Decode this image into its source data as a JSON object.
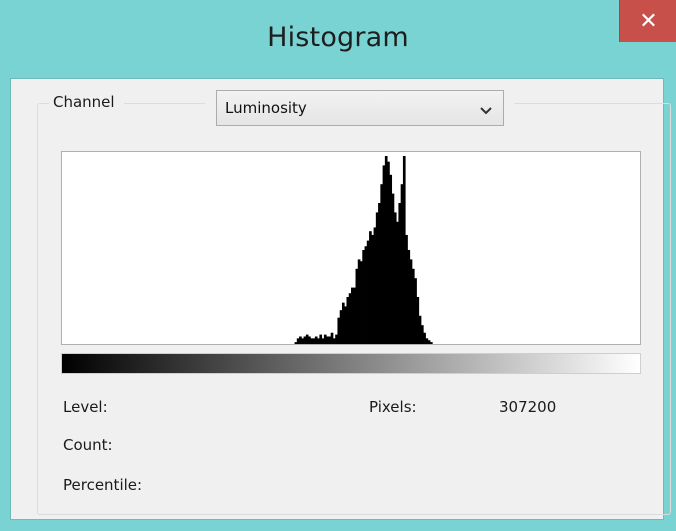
{
  "window": {
    "title": "Histogram",
    "close_glyph": "✕"
  },
  "channel": {
    "label": "Channel",
    "selected": "Luminosity"
  },
  "stats": {
    "level_label": "Level:",
    "count_label": "Count:",
    "percentile_label": "Percentile:",
    "pixels_label": "Pixels:",
    "pixels_value": "307200"
  },
  "chart_data": {
    "type": "area",
    "title": "",
    "xlabel": "",
    "ylabel": "",
    "xlim": [
      0,
      255
    ],
    "ylim": [
      0,
      1
    ],
    "grid": false,
    "x": [
      102,
      103,
      104,
      105,
      106,
      107,
      108,
      109,
      110,
      111,
      112,
      113,
      114,
      115,
      116,
      117,
      118,
      119,
      120,
      121,
      122,
      123,
      124,
      125,
      126,
      127,
      128,
      129,
      130,
      131,
      132,
      133,
      134,
      135,
      136,
      137,
      138,
      139,
      140,
      141,
      142,
      143,
      144,
      145,
      146,
      147,
      148,
      149,
      150,
      151,
      152,
      153,
      154,
      155,
      156,
      157,
      158,
      159,
      160,
      161,
      162,
      163,
      164,
      165,
      166,
      167,
      168,
      169
    ],
    "values": [
      0.0,
      0.01,
      0.03,
      0.04,
      0.03,
      0.04,
      0.05,
      0.04,
      0.03,
      0.03,
      0.04,
      0.03,
      0.05,
      0.03,
      0.05,
      0.04,
      0.04,
      0.06,
      0.03,
      0.05,
      0.14,
      0.18,
      0.22,
      0.2,
      0.25,
      0.27,
      0.3,
      0.3,
      0.4,
      0.45,
      0.44,
      0.5,
      0.52,
      0.55,
      0.6,
      0.58,
      0.62,
      0.7,
      0.75,
      0.85,
      0.95,
      1.0,
      0.97,
      0.9,
      0.8,
      0.7,
      0.65,
      0.75,
      0.85,
      1.0,
      0.58,
      0.5,
      0.45,
      0.4,
      0.35,
      0.25,
      0.15,
      0.1,
      0.06,
      0.03,
      0.02,
      0.01,
      0.0,
      0.0,
      0.0,
      0.0,
      0.0,
      0.0
    ]
  }
}
